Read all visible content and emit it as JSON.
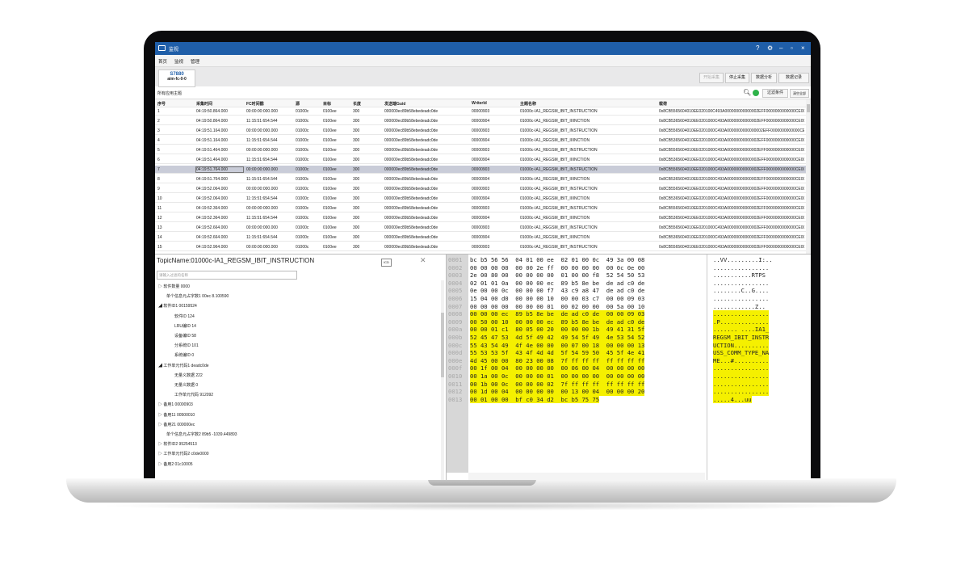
{
  "app": {
    "title": "监视"
  },
  "menu": [
    "首页",
    "监视",
    "管理"
  ],
  "device": {
    "name": "S7880",
    "id": "aim-fc-0-0"
  },
  "toolbar": {
    "start": "开始采集",
    "stop": "停止采集",
    "analyze": "数据分析",
    "record": "数据记录"
  },
  "topic": {
    "label": "所有应用主题",
    "filter": "过滤条件",
    "clear": "清空全部"
  },
  "table": {
    "columns": [
      "序号",
      "采集时间",
      "FC时间戳",
      "源",
      "目标",
      "长度",
      "发送端Guid",
      "WriterId",
      "主题名称",
      "载荷"
    ],
    "rows": [
      [
        "1",
        "04:19:50.864.000",
        "00:00:00:000.000",
        "01000c",
        "0100ee",
        "300",
        "000000ec89b58ebedeadc0de",
        "00000903",
        "01000c-IA1_REGSM_IBIT_INSTRUCTION",
        "0x8CB5565604010EE020100C493A000000000000002EFF0000000000000CE00"
      ],
      [
        "2",
        "04:19:50.864.000",
        "11:15:51:654.544",
        "01000c",
        "0100ee",
        "300",
        "000000ec89b58ebedeadc0de",
        "00000904",
        "01000c-IA1_REGSM_IBIT_IIIINCTION",
        "0x8CB5365604010EE0201000C493A00000000000002EFF0000000000000CE00"
      ],
      [
        "3",
        "04:19:51.164.000",
        "00:00:00:000.000",
        "01000c",
        "0100ee",
        "300",
        "000000ec89b58ebedeadc0de",
        "00000903",
        "01000c-IA1_REGSM_IBIT_INSTRUCTION",
        "0x8CB5565604010EE0201000C493A0000000000000002EFF0000000000000CE00"
      ],
      [
        "4",
        "04:19:51.164.000",
        "11:15:51:654.544",
        "01000c",
        "0100ee",
        "300",
        "000000ec89b58ebedeadc0de",
        "00000904",
        "01000c-IA1_REGSM_IBIT_IIIINCTION",
        "0x8CB5365604010EE0201000C493A00000000000002EFF0000000000000CE00"
      ],
      [
        "5",
        "04:19:51.464.000",
        "00:00:00:000.000",
        "01000c",
        "0100ee",
        "300",
        "000000ec89b58ebedeadc0de",
        "00000903",
        "01000c-IA1_REGSM_IBIT_INSTRUCTION",
        "0x8CB5565604010EE0201000C493A00000000000002EFF0000000000000CE00"
      ],
      [
        "6",
        "04:19:51.464.000",
        "11:15:51:654.544",
        "01000c",
        "0100ee",
        "300",
        "000000ec89b58ebedeadc0de",
        "00000904",
        "01000c-IA1_REGSM_IBIT_IIIINCTION",
        "0x8CB5365604010EE0201000C493A00000000000002EFF0000000000000CE00"
      ],
      [
        "7",
        "04:19:51.764.000",
        "00:00:00:000.000",
        "01000c",
        "0100ee",
        "300",
        "000000ec89b58ebedeadc0de",
        "00000903",
        "01000c-IA1_REGSM_IBIT_INSTRUCTION",
        "0x8CB5565604010EE0201000C493A00000000000002EFF0000000000000CE00"
      ],
      [
        "8",
        "04:19:51.764.000",
        "11:15:51:654.544",
        "01000c",
        "0100ee",
        "300",
        "000000ec89b58ebedeadc0de",
        "00000904",
        "01000c-IA1_REGSM_IBIT_IIIINCTION",
        "0x8CB5365604010EE0201000C493A00000000000002EFF0000000000000CE00"
      ],
      [
        "9",
        "04:19:52.064.000",
        "00:00:00:000.000",
        "01000c",
        "0100ee",
        "300",
        "000000ec89b58ebedeadc0de",
        "00000903",
        "01000c-IA1_REGSM_IBIT_INSTRUCTION",
        "0x8CB5565604010EE0201000C493A00000000000002EFF0000000000000CE00"
      ],
      [
        "10",
        "04:19:52.064.000",
        "11:15:51:654.544",
        "01000c",
        "0100ee",
        "300",
        "000000ec89b58ebedeadc0de",
        "00000904",
        "01000c-IA1_REGSM_IBIT_IIIINCTION",
        "0x8CB5365604010EE0201000C493A00000000000002EFF0000000000000CE00"
      ],
      [
        "11",
        "04:19:52.364.000",
        "00:00:00:000.000",
        "01000c",
        "0100ee",
        "300",
        "000000ec89b58ebedeadc0de",
        "00000903",
        "01000c-IA1_REGSM_IBIT_INSTRUCTION",
        "0x8CB5565604010EE0201000C493A00000000000002EFF0000000000000CE00"
      ],
      [
        "12",
        "04:19:52.364.000",
        "11:15:51:654.544",
        "01000c",
        "0100ee",
        "300",
        "000000ec89b58ebedeadc0de",
        "00000904",
        "01000c-IA1_REGSM_IBIT_IIIINCTION",
        "0x8CB5365604010EE0201000C493A00000000000002EFF0000000000000CE00"
      ],
      [
        "13",
        "04:19:52.664.000",
        "00:00:00:000.000",
        "01000c",
        "0100ee",
        "300",
        "000000ec89b58ebedeadc0de",
        "00000903",
        "01000c-IA1_REGSM_IBIT_INSTRUCTION",
        "0x8CB5565604010EE0201000C493A00000000000002EFF0000000000000CE00"
      ],
      [
        "14",
        "04:19:52.664.000",
        "11:15:51:654.544",
        "01000c",
        "0100ee",
        "300",
        "000000ec89b58ebedeadc0de",
        "00000904",
        "01000c-IA1_REGSM_IBIT_IIIINCTION",
        "0x8CB5365604010EE0201000C493A00000000000002EFF0000000000000CE00"
      ],
      [
        "15",
        "04:19:52.964.000",
        "00:00:00:000.000",
        "01000c",
        "0100ee",
        "300",
        "000000ec89b58ebedeadc0de",
        "00000903",
        "01000c-IA1_REGSM_IBIT_INSTRUCTION",
        "0x8CB5565604010EE0201000C493A00000000000002EFF0000000000000CE00"
      ]
    ],
    "selected_row": "7"
  },
  "detail": {
    "topic_name": "TopicName:01000c-IA1_REGSM_IBIT_INSTRUCTION",
    "icon_label": "ICD",
    "search_placeholder": "请输入过滤的名称",
    "tree": [
      {
        "label": "▷  软件数量    0000",
        "indent": 0
      },
      {
        "label": "单个信息元占字数1   00ec  8.100590",
        "indent": 1
      },
      {
        "label": "◢  软件ID1    00159524",
        "indent": 0
      },
      {
        "label": "软件ID   124",
        "indent": 2
      },
      {
        "label": "LRU编ID   14",
        "indent": 2
      },
      {
        "label": "设备编ID   58",
        "indent": 2
      },
      {
        "label": "分系统ID   101",
        "indent": 2
      },
      {
        "label": "系统编ID   0",
        "indent": 2
      },
      {
        "label": "◢  工作单元代码1    deadc0de",
        "indent": 0
      },
      {
        "label": "无量义数据   222",
        "indent": 2
      },
      {
        "label": "无量义数据   0",
        "indent": 2
      },
      {
        "label": "工作单元代码   912092",
        "indent": 2
      },
      {
        "label": "▷  备用1    00000903",
        "indent": 0
      },
      {
        "label": "▷  备用11    00500010",
        "indent": 0
      },
      {
        "label": "▷  备用21    000000ec",
        "indent": 0
      },
      {
        "label": "单个信息元占字数2   89b5  -1039.449893",
        "indent": 1
      },
      {
        "label": "▷  软件ID2    95254513",
        "indent": 0
      },
      {
        "label": "▷  工作单元代码2    c0de0000",
        "indent": 0
      },
      {
        "label": "▷  备用2    01c10005",
        "indent": 0
      }
    ]
  },
  "hex": {
    "lines": [
      {
        "off": "0001",
        "bytes": "bc b5 56 56  04 01 00 ee  02 01 00 0c  49 3a 00 08",
        "ascii": "..VV.........I:..",
        "hl": false
      },
      {
        "off": "0002",
        "bytes": "00 00 00 00  00 00 2e ff  00 00 00 00  00 0c 0e 00",
        "ascii": "................",
        "hl": false
      },
      {
        "off": "0003",
        "bytes": "2e 00 80 00  00 00 00 00  01 00 00 f8  52 54 50 53",
        "ascii": "...........RTPS",
        "hl": false
      },
      {
        "off": "0004",
        "bytes": "02 01 01 0a  00 00 00 ec  89 b5 8e be  de ad c0 de",
        "ascii": "................",
        "hl": false
      },
      {
        "off": "0005",
        "bytes": "0e 00 00 0c  00 00 00 f7  43 c9 a8 47  de ad c0 de",
        "ascii": "........C..G....",
        "hl": false
      },
      {
        "off": "0006",
        "bytes": "15 04 00 d0  00 00 00 10  00 00 03 c7  00 00 09 03",
        "ascii": "................",
        "hl": false
      },
      {
        "off": "0007",
        "bytes": "00 00 00 00  00 00 00 01  00 02 00 00  00 5a 00 10",
        "ascii": "............Z..",
        "hl": false
      },
      {
        "off": "0008",
        "bytes": "00 00 00 ec  89 b5 8e be  de ad c0 de  00 00 09 03",
        "ascii": "................",
        "hl": true
      },
      {
        "off": "0009",
        "bytes": "00 50 00 10  00 00 00 ec  89 b5 8e be  de ad c0 de",
        "ascii": ".P..............",
        "hl": true
      },
      {
        "off": "000a",
        "bytes": "00 00 01 c1  80 05 00 20  00 00 00 1b  49 41 31 5f",
        "ascii": "....... ....IA1_",
        "hl": true
      },
      {
        "off": "000b",
        "bytes": "52 45 47 53  4d 5f 49 42  49 54 5f 49  4e 53 54 52",
        "ascii": "REGSM_IBIT_INSTR",
        "hl": true
      },
      {
        "off": "000c",
        "bytes": "55 43 54 49  4f 4e 00 00  00 07 00 18  00 00 00 13",
        "ascii": "UCTION..........",
        "hl": true
      },
      {
        "off": "000d",
        "bytes": "55 53 53 5f  43 4f 4d 4d  5f 54 59 50  45 5f 4e 41",
        "ascii": "USS_COMM_TYPE_NA",
        "hl": true
      },
      {
        "off": "000e",
        "bytes": "4d 45 00 00  80 23 00 08  7f ff ff ff  ff ff ff ff",
        "ascii": "ME...#..........",
        "hl": true
      },
      {
        "off": "000f",
        "bytes": "00 1f 00 04  00 00 00 00  00 06 00 04  00 00 00 00",
        "ascii": "................",
        "hl": true
      },
      {
        "off": "0010",
        "bytes": "00 1a 00 0c  00 00 00 01  00 00 00 00  00 00 00 00",
        "ascii": "................",
        "hl": true
      },
      {
        "off": "0011",
        "bytes": "00 1b 00 0c  00 00 00 02  7f ff ff ff  ff ff ff ff",
        "ascii": "................",
        "hl": true
      },
      {
        "off": "0012",
        "bytes": "00 1d 00 04  00 00 00 00  00 13 00 04  00 00 00 20",
        "ascii": "................",
        "hl": true
      },
      {
        "off": "0013",
        "bytes": "00 01 00 00  bf c0 34 d2  bc b5 75 75",
        "ascii": ".....4...uu",
        "hl": "partial"
      }
    ]
  },
  "colors": {
    "titlebar": "#1f5ea8",
    "highlight": "#f5f000",
    "selected_row": "#c9ccd8",
    "status_green": "#2fb34a"
  }
}
